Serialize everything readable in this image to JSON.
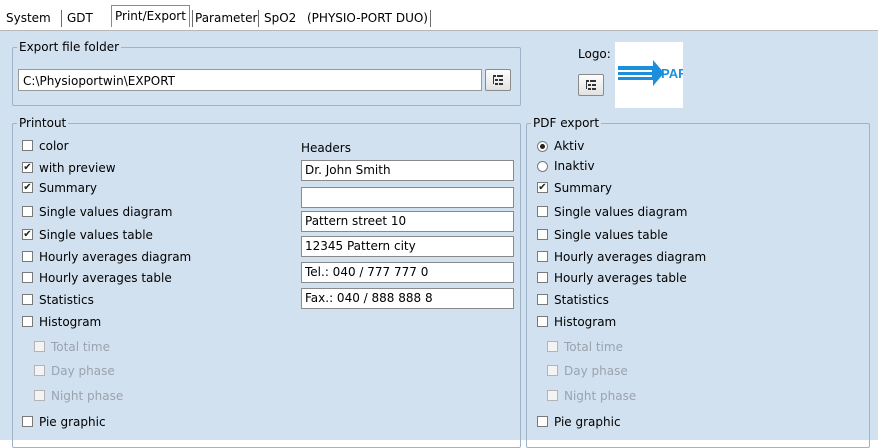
{
  "tabs": [
    {
      "label": "System"
    },
    {
      "label": "GDT"
    },
    {
      "label": "Print/Export"
    },
    {
      "label": "Parameter"
    },
    {
      "label": "SpO2"
    },
    {
      "label": "(PHYSIO-PORT DUO)"
    }
  ],
  "active_tab": "Print/Export",
  "export": {
    "legend": "Export file folder",
    "path": "C:\\Physioportwin\\EXPORT"
  },
  "logo": {
    "label": "Logo:",
    "image_text": "PAR"
  },
  "printout": {
    "legend": "Printout",
    "items": [
      {
        "label": "color",
        "checked": false,
        "disabled": false
      },
      {
        "label": "with preview",
        "checked": true,
        "disabled": false
      },
      {
        "label": "Summary",
        "checked": true,
        "disabled": false
      },
      {
        "label": "Single values diagram",
        "checked": false,
        "disabled": false
      },
      {
        "label": "Single values table",
        "checked": true,
        "disabled": false
      },
      {
        "label": "Hourly averages diagram",
        "checked": false,
        "disabled": false
      },
      {
        "label": "Hourly averages table",
        "checked": false,
        "disabled": false
      },
      {
        "label": "Statistics",
        "checked": false,
        "disabled": false
      },
      {
        "label": "Histogram",
        "checked": false,
        "disabled": false
      },
      {
        "label": "Total time",
        "checked": false,
        "disabled": true
      },
      {
        "label": "Day phase",
        "checked": false,
        "disabled": true
      },
      {
        "label": "Night phase",
        "checked": false,
        "disabled": true
      },
      {
        "label": "Pie graphic",
        "checked": false,
        "disabled": false
      }
    ]
  },
  "headers": {
    "label": "Headers",
    "lines": [
      "Dr. John Smith",
      "",
      "Pattern street 10",
      "12345 Pattern city",
      "Tel.: 040 / 777 777 0",
      "Fax.: 040 / 888 888 8"
    ]
  },
  "pdf": {
    "legend": "PDF export",
    "radio": [
      {
        "label": "Aktiv",
        "selected": true
      },
      {
        "label": "Inaktiv",
        "selected": false
      }
    ],
    "items": [
      {
        "label": "Summary",
        "checked": true,
        "disabled": false
      },
      {
        "label": "Single values diagram",
        "checked": false,
        "disabled": false
      },
      {
        "label": "Single values table",
        "checked": false,
        "disabled": false
      },
      {
        "label": "Hourly averages diagram",
        "checked": false,
        "disabled": false
      },
      {
        "label": "Hourly averages table",
        "checked": false,
        "disabled": false
      },
      {
        "label": "Statistics",
        "checked": false,
        "disabled": false
      },
      {
        "label": "Histogram",
        "checked": false,
        "disabled": false
      },
      {
        "label": "Total time",
        "checked": false,
        "disabled": true
      },
      {
        "label": "Day phase",
        "checked": false,
        "disabled": true
      },
      {
        "label": "Night phase",
        "checked": false,
        "disabled": true
      },
      {
        "label": "Pie graphic",
        "checked": false,
        "disabled": false
      }
    ]
  },
  "colors": {
    "panel_bg": "#d2e1f0",
    "logo_blue": "#1c8fdc"
  }
}
